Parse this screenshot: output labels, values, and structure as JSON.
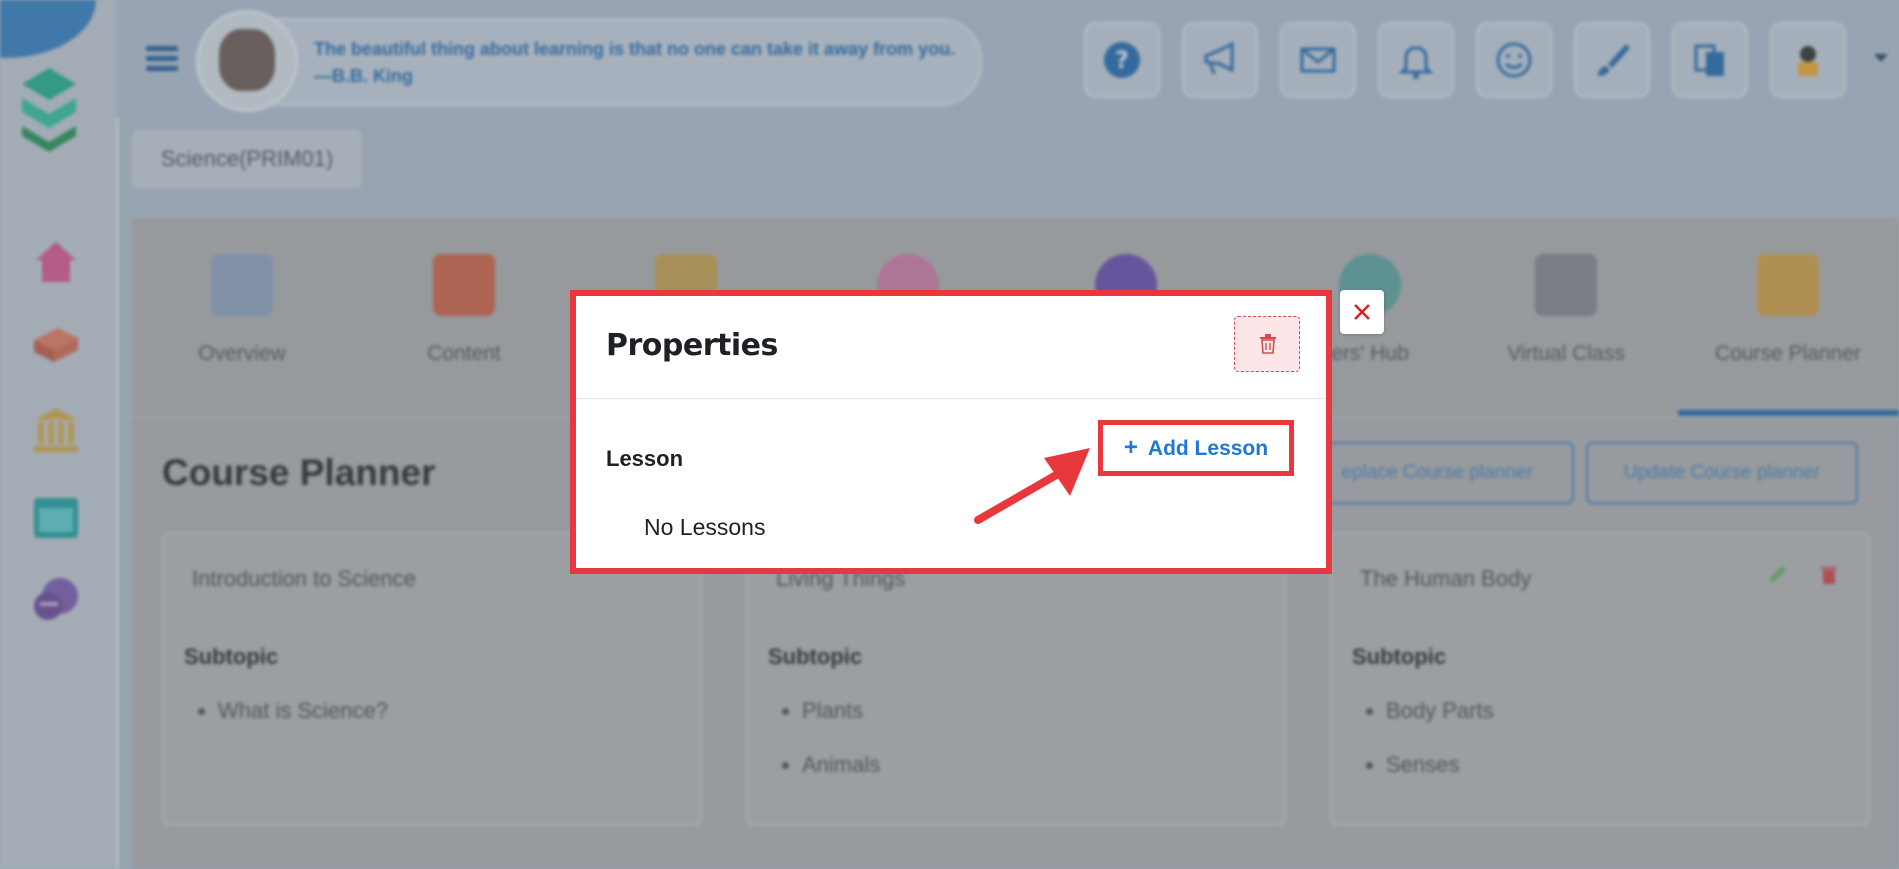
{
  "header": {
    "quote": "The beautiful thing about learning is that no one can take it away from you. —B.B. King",
    "buttons": [
      "help-icon",
      "announcement-icon",
      "mail-icon",
      "bell-icon",
      "smiley-icon",
      "paintbrush-icon",
      "translate-icon",
      "profile-avatar"
    ]
  },
  "course_chip": "Science(PRIM01)",
  "tabs": [
    {
      "label": "Overview",
      "icon": "overview-icon"
    },
    {
      "label": "Content",
      "icon": "content-icon"
    },
    {
      "label": "",
      "icon": "tab3-icon"
    },
    {
      "label": "",
      "icon": "tab4-icon"
    },
    {
      "label": "",
      "icon": "tab5-icon"
    },
    {
      "label": "ers' Hub",
      "icon": "hub-icon"
    },
    {
      "label": "Virtual Class",
      "icon": "virtual-class-icon"
    },
    {
      "label": "Course Planner",
      "icon": "course-planner-icon"
    }
  ],
  "planner": {
    "title": "Course Planner",
    "replace_btn": "eplace Course planner",
    "update_btn": "Update Course planner",
    "cards": [
      {
        "title": "Introduction to Science",
        "subtopic_label": "Subtopic",
        "items": [
          "What is Science?"
        ]
      },
      {
        "title": "Living Things",
        "subtopic_label": "Subtopic",
        "items": [
          "Plants",
          "Animals"
        ]
      },
      {
        "title": "The Human Body",
        "subtopic_label": "Subtopic",
        "items": [
          "Body Parts",
          "Senses"
        ]
      }
    ]
  },
  "modal": {
    "title": "Properties",
    "section_label": "Lesson",
    "add_button": "Add Lesson",
    "empty_text": "No Lessons"
  },
  "colors": {
    "accent_red": "#e8383d",
    "link_blue": "#1f77d6",
    "brand_blue": "#2d6ca8"
  }
}
